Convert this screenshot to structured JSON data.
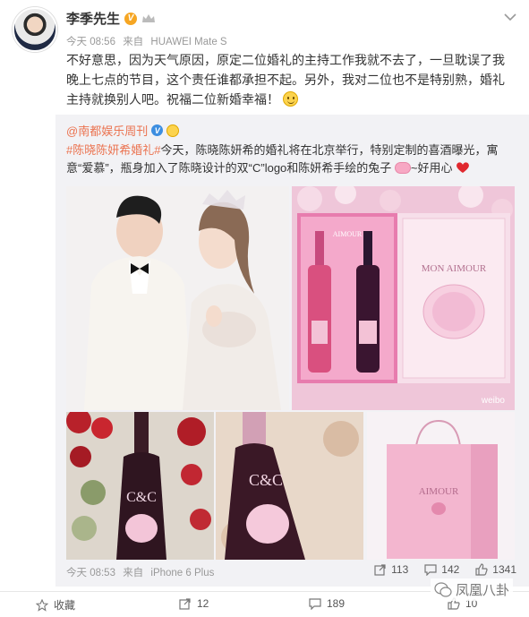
{
  "post": {
    "username": "李季先生",
    "time": "今天 08:56",
    "source_prefix": "来自",
    "source": "HUAWEI Mate S",
    "text": "不好意思，因为天气原因，原定二位婚礼的主持工作我就不去了，一旦耽误了我晚上七点的节目，这个责任谁都承担不起。另外，我对二位也不是特别熟，婚礼主持就换别人吧。祝福二位新婚幸福！"
  },
  "repost": {
    "author": "@南都娱乐周刊",
    "hashtag": "#陈晓陈妍希婚礼#",
    "text_a": "今天，陈晓陈妍希的婚礼将在北京举行，特别定制的喜酒曝光，寓意“爱慕”，瓶身加入了陈晓设计的双“C”logo和陈妍希手绘的兔子",
    "text_b": "~好用心",
    "images": {
      "box_brand": "AIMOUR",
      "box_label": "MON AIMOUR",
      "bottle_logo": "C&C",
      "bag_label": "AIMOUR",
      "photo_watermark": "weibo"
    },
    "time": "今天 08:53",
    "source_prefix": "来自",
    "source": "iPhone 6 Plus",
    "forwards": "113",
    "comments": "142",
    "likes": "1341"
  },
  "footer": {
    "favorite": "收藏",
    "forwards": "12",
    "comments": "189",
    "likes": "10"
  },
  "watermark": "凤凰八卦",
  "colors": {
    "link": "#eb7350",
    "verified_gold": "#f6a623",
    "verified_blue": "#3d8ee0",
    "repost_bg": "#f2f2f5"
  }
}
